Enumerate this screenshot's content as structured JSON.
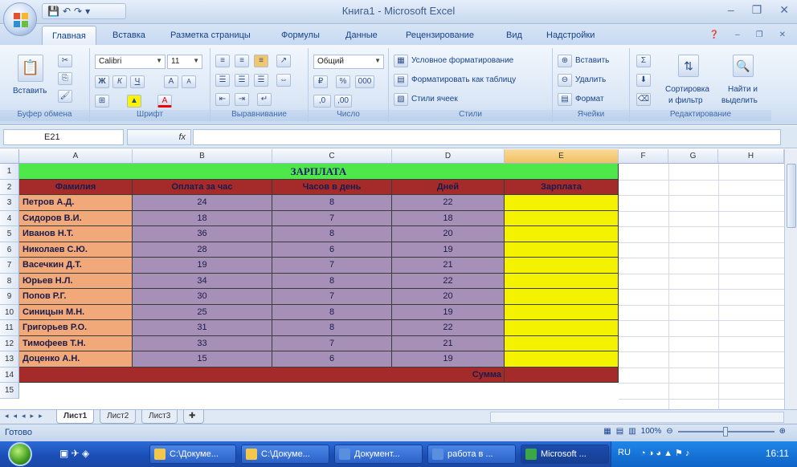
{
  "window": {
    "title": "Книга1 - Microsoft Excel"
  },
  "tabs": [
    "Главная",
    "Вставка",
    "Разметка страницы",
    "Формулы",
    "Данные",
    "Рецензирование",
    "Вид",
    "Надстройки"
  ],
  "ribbon": {
    "clipboard": {
      "paste_label": "Вставить",
      "group_label": "Буфер обмена"
    },
    "font": {
      "font_name": "Calibri",
      "font_size": "11",
      "group_label": "Шрифт"
    },
    "alignment": {
      "group_label": "Выравнивание"
    },
    "number": {
      "format": "Общий",
      "group_label": "Число"
    },
    "styles": {
      "conditional": "Условное форматирование",
      "as_table": "Форматировать как таблицу",
      "cell_styles": "Стили ячеек",
      "group_label": "Стили"
    },
    "cells": {
      "insert": "Вставить",
      "delete": "Удалить",
      "format": "Формат",
      "group_label": "Ячейки"
    },
    "editing": {
      "sort_line1": "Сортировка",
      "sort_line2": "и фильтр",
      "find_line1": "Найти и",
      "find_line2": "выделить",
      "group_label": "Редактирование"
    }
  },
  "formula_bar": {
    "name_box": "E21",
    "fx": "fx",
    "formula": ""
  },
  "columns": [
    "A",
    "B",
    "C",
    "D",
    "E",
    "F",
    "G",
    "H"
  ],
  "table": {
    "title": "ЗАРПЛАТА",
    "headers": [
      "Фамилия",
      "Оплата за час",
      "Часов в день",
      "Дней",
      "Зарплата"
    ],
    "rows": [
      [
        "Петров А.Д.",
        "24",
        "8",
        "22"
      ],
      [
        "Сидоров В.И.",
        "18",
        "7",
        "18"
      ],
      [
        "Иванов Н.Т.",
        "36",
        "8",
        "20"
      ],
      [
        "Николаев С.Ю.",
        "28",
        "6",
        "19"
      ],
      [
        "Васечкин Д.Т.",
        "19",
        "7",
        "21"
      ],
      [
        "Юрьев Н.Л.",
        "34",
        "8",
        "22"
      ],
      [
        "Попов Р.Г.",
        "30",
        "7",
        "20"
      ],
      [
        "Синицын М.Н.",
        "25",
        "8",
        "19"
      ],
      [
        "Григорьев Р.О.",
        "31",
        "8",
        "22"
      ],
      [
        "Тимофеев Т.Н.",
        "33",
        "7",
        "21"
      ],
      [
        "Доценко А.Н.",
        "15",
        "6",
        "19"
      ]
    ],
    "total_label": "Сумма"
  },
  "row_numbers": [
    "1",
    "2",
    "3",
    "4",
    "5",
    "6",
    "7",
    "8",
    "9",
    "10",
    "11",
    "12",
    "13",
    "14",
    "15"
  ],
  "sheets": [
    "Лист1",
    "Лист2",
    "Лист3"
  ],
  "status": {
    "ready": "Готово",
    "zoom": "100%"
  },
  "taskbar": {
    "buttons": [
      "C:\\Докуме...",
      "C:\\Докуме...",
      "Документ...",
      "работа в ...",
      "Microsoft ..."
    ],
    "lang": "RU",
    "clock": "16:11"
  },
  "colors": {
    "title_green": "#4ee84a",
    "header_red": "#a52a2a",
    "name_orange": "#f2a97a",
    "data_purple": "#a690b8",
    "salary_yellow": "#f5f200",
    "selected_col": "#f1c15f"
  }
}
